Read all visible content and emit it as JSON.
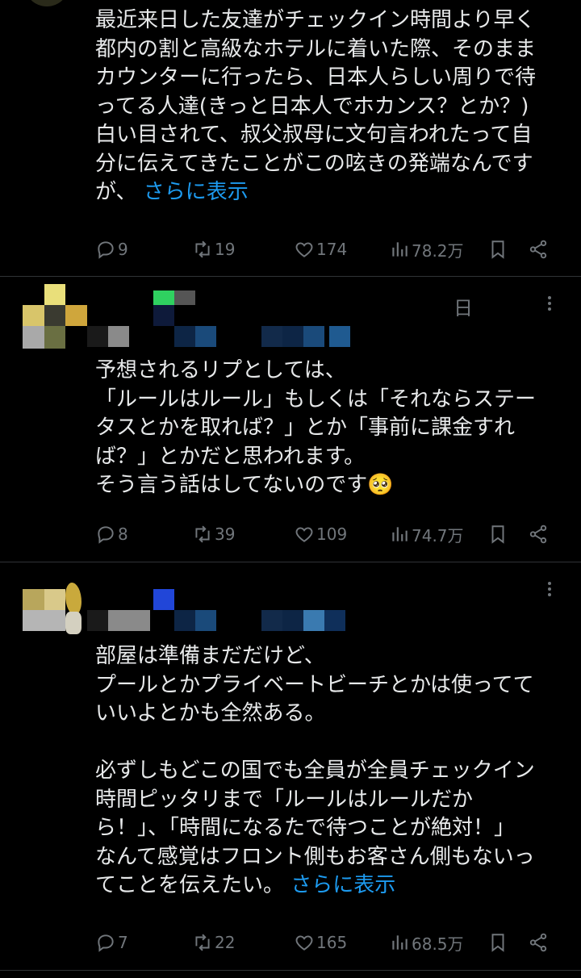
{
  "tweets": [
    {
      "text": "最近来日した友達がチェックイン時間より早く\n都内の割と高級なホテルに着いた際、そのまま\nカウンターに行ったら、日本人らしい周りで待\nってる人達(きっと日本人でホカンス？とか？)\n白い目されて、叔父叔母に文句言われたって自\n分に伝えてきたことがこの呟きの発端なんです\nが、",
      "more": "さらに表示",
      "replies": "9",
      "retweets": "19",
      "likes": "174",
      "views": "78.2万"
    },
    {
      "header_fragment": "日",
      "text": "予想されるリプとしては、\n「ルールはルール」もしくは「それならステー\nタスとかを取れば？」とか「事前に課金すれ\nば？」とかだと思われます。\nそう言う話はしてないのです🥺",
      "replies": "8",
      "retweets": "39",
      "likes": "109",
      "views": "74.7万"
    },
    {
      "text": "部屋は準備まだだけど、\nプールとかプライベートビーチとかは使ってて\nいいよとかも全然ある。\n\n必ずしもどこの国でも全員が全員チェックイン\n時間ピッタリまで「ルールはルールだか\nら！」、「時間になるたで待つことが絶対！」\nなんて感覚はフロント側もお客さん側もないっ\nてことを伝えたい。",
      "more": "さらに表示",
      "replies": "7",
      "retweets": "22",
      "likes": "165",
      "views": "68.5万"
    }
  ],
  "icons": {
    "reply": "reply-icon",
    "retweet": "retweet-icon",
    "like": "heart-icon",
    "views": "views-icon",
    "bookmark": "bookmark-icon",
    "share": "share-icon",
    "more": "more-dots-icon"
  },
  "colors": {
    "background": "#000000",
    "text": "#e7e9ea",
    "muted": "#71767b",
    "link": "#1d9bf0",
    "separator": "#2f3336"
  }
}
